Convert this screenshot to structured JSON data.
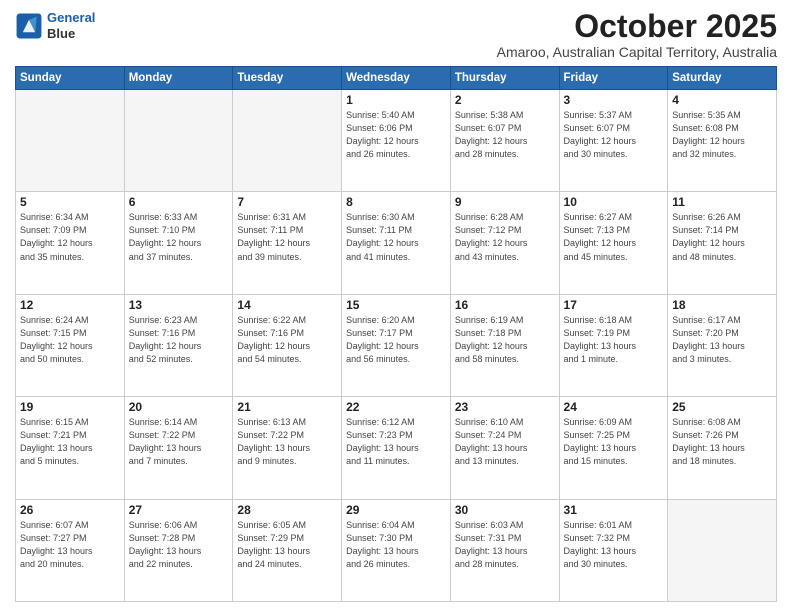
{
  "logo": {
    "line1": "General",
    "line2": "Blue"
  },
  "title": "October 2025",
  "location": "Amaroo, Australian Capital Territory, Australia",
  "days_of_week": [
    "Sunday",
    "Monday",
    "Tuesday",
    "Wednesday",
    "Thursday",
    "Friday",
    "Saturday"
  ],
  "weeks": [
    [
      {
        "day": "",
        "info": ""
      },
      {
        "day": "",
        "info": ""
      },
      {
        "day": "",
        "info": ""
      },
      {
        "day": "1",
        "info": "Sunrise: 5:40 AM\nSunset: 6:06 PM\nDaylight: 12 hours\nand 26 minutes."
      },
      {
        "day": "2",
        "info": "Sunrise: 5:38 AM\nSunset: 6:07 PM\nDaylight: 12 hours\nand 28 minutes."
      },
      {
        "day": "3",
        "info": "Sunrise: 5:37 AM\nSunset: 6:07 PM\nDaylight: 12 hours\nand 30 minutes."
      },
      {
        "day": "4",
        "info": "Sunrise: 5:35 AM\nSunset: 6:08 PM\nDaylight: 12 hours\nand 32 minutes."
      }
    ],
    [
      {
        "day": "5",
        "info": "Sunrise: 6:34 AM\nSunset: 7:09 PM\nDaylight: 12 hours\nand 35 minutes."
      },
      {
        "day": "6",
        "info": "Sunrise: 6:33 AM\nSunset: 7:10 PM\nDaylight: 12 hours\nand 37 minutes."
      },
      {
        "day": "7",
        "info": "Sunrise: 6:31 AM\nSunset: 7:11 PM\nDaylight: 12 hours\nand 39 minutes."
      },
      {
        "day": "8",
        "info": "Sunrise: 6:30 AM\nSunset: 7:11 PM\nDaylight: 12 hours\nand 41 minutes."
      },
      {
        "day": "9",
        "info": "Sunrise: 6:28 AM\nSunset: 7:12 PM\nDaylight: 12 hours\nand 43 minutes."
      },
      {
        "day": "10",
        "info": "Sunrise: 6:27 AM\nSunset: 7:13 PM\nDaylight: 12 hours\nand 45 minutes."
      },
      {
        "day": "11",
        "info": "Sunrise: 6:26 AM\nSunset: 7:14 PM\nDaylight: 12 hours\nand 48 minutes."
      }
    ],
    [
      {
        "day": "12",
        "info": "Sunrise: 6:24 AM\nSunset: 7:15 PM\nDaylight: 12 hours\nand 50 minutes."
      },
      {
        "day": "13",
        "info": "Sunrise: 6:23 AM\nSunset: 7:16 PM\nDaylight: 12 hours\nand 52 minutes."
      },
      {
        "day": "14",
        "info": "Sunrise: 6:22 AM\nSunset: 7:16 PM\nDaylight: 12 hours\nand 54 minutes."
      },
      {
        "day": "15",
        "info": "Sunrise: 6:20 AM\nSunset: 7:17 PM\nDaylight: 12 hours\nand 56 minutes."
      },
      {
        "day": "16",
        "info": "Sunrise: 6:19 AM\nSunset: 7:18 PM\nDaylight: 12 hours\nand 58 minutes."
      },
      {
        "day": "17",
        "info": "Sunrise: 6:18 AM\nSunset: 7:19 PM\nDaylight: 13 hours\nand 1 minute."
      },
      {
        "day": "18",
        "info": "Sunrise: 6:17 AM\nSunset: 7:20 PM\nDaylight: 13 hours\nand 3 minutes."
      }
    ],
    [
      {
        "day": "19",
        "info": "Sunrise: 6:15 AM\nSunset: 7:21 PM\nDaylight: 13 hours\nand 5 minutes."
      },
      {
        "day": "20",
        "info": "Sunrise: 6:14 AM\nSunset: 7:22 PM\nDaylight: 13 hours\nand 7 minutes."
      },
      {
        "day": "21",
        "info": "Sunrise: 6:13 AM\nSunset: 7:22 PM\nDaylight: 13 hours\nand 9 minutes."
      },
      {
        "day": "22",
        "info": "Sunrise: 6:12 AM\nSunset: 7:23 PM\nDaylight: 13 hours\nand 11 minutes."
      },
      {
        "day": "23",
        "info": "Sunrise: 6:10 AM\nSunset: 7:24 PM\nDaylight: 13 hours\nand 13 minutes."
      },
      {
        "day": "24",
        "info": "Sunrise: 6:09 AM\nSunset: 7:25 PM\nDaylight: 13 hours\nand 15 minutes."
      },
      {
        "day": "25",
        "info": "Sunrise: 6:08 AM\nSunset: 7:26 PM\nDaylight: 13 hours\nand 18 minutes."
      }
    ],
    [
      {
        "day": "26",
        "info": "Sunrise: 6:07 AM\nSunset: 7:27 PM\nDaylight: 13 hours\nand 20 minutes."
      },
      {
        "day": "27",
        "info": "Sunrise: 6:06 AM\nSunset: 7:28 PM\nDaylight: 13 hours\nand 22 minutes."
      },
      {
        "day": "28",
        "info": "Sunrise: 6:05 AM\nSunset: 7:29 PM\nDaylight: 13 hours\nand 24 minutes."
      },
      {
        "day": "29",
        "info": "Sunrise: 6:04 AM\nSunset: 7:30 PM\nDaylight: 13 hours\nand 26 minutes."
      },
      {
        "day": "30",
        "info": "Sunrise: 6:03 AM\nSunset: 7:31 PM\nDaylight: 13 hours\nand 28 minutes."
      },
      {
        "day": "31",
        "info": "Sunrise: 6:01 AM\nSunset: 7:32 PM\nDaylight: 13 hours\nand 30 minutes."
      },
      {
        "day": "",
        "info": ""
      }
    ]
  ]
}
